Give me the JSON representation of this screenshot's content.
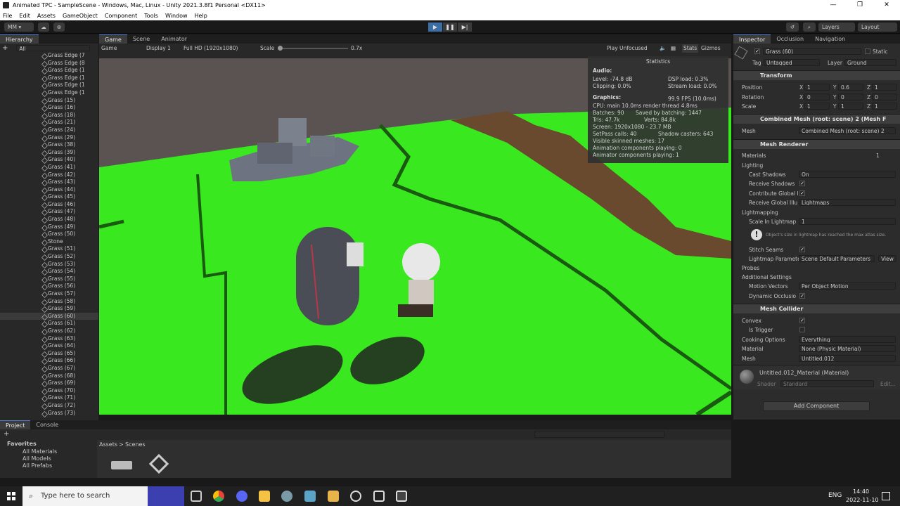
{
  "window": {
    "title": "Animated TPC - SampleScene - Windows, Mac, Linux - Unity 2021.3.8f1 Personal <DX11>",
    "min": "—",
    "max": "❐",
    "close": "✕"
  },
  "menu": [
    "File",
    "Edit",
    "Assets",
    "GameObject",
    "Component",
    "Tools",
    "Window",
    "Help"
  ],
  "toolbar": {
    "account": "MM ▾",
    "layers": "Layers",
    "layout": "Layout"
  },
  "hierarchy": {
    "tab": "Hierarchy",
    "search_placeholder": "All",
    "items": [
      "Grass Edge (7",
      "Grass Edge (8",
      "Grass Edge (1",
      "Grass Edge (1",
      "Grass Edge (1",
      "Grass Edge (1",
      "Grass (15)",
      "Grass (16)",
      "Grass (18)",
      "Grass (21)",
      "Grass (24)",
      "Grass (29)",
      "Grass (38)",
      "Grass (39)",
      "Grass (40)",
      "Grass (41)",
      "Grass (42)",
      "Grass (43)",
      "Grass (44)",
      "Grass (45)",
      "Grass (46)",
      "Grass (47)",
      "Grass (48)",
      "Grass (49)",
      "Grass (50)",
      "Stone",
      "Grass (51)",
      "Grass (52)",
      "Grass (53)",
      "Grass (54)",
      "Grass (55)",
      "Grass (56)",
      "Grass (57)",
      "Grass (58)",
      "Grass (59)",
      "Grass (60)",
      "Grass (61)",
      "Grass (62)",
      "Grass (63)",
      "Grass (64)",
      "Grass (65)",
      "Grass (66)",
      "Grass (67)",
      "Grass (68)",
      "Grass (69)",
      "Grass (70)",
      "Grass (71)",
      "Grass (72)",
      "Grass (73)"
    ],
    "selected_index": 35
  },
  "game": {
    "tabs": [
      "Game",
      "Scene",
      "Animator"
    ],
    "mode": "Game",
    "display": "Display 1",
    "resolution": "Full HD (1920x1080)",
    "scale_label": "Scale",
    "scale_value": "0.7x",
    "play_mode": "Play Unfocused",
    "stats_btn": "Stats",
    "gizmos_btn": "Gizmos"
  },
  "stats": {
    "title": "Statistics",
    "audio": "Audio:",
    "level": "Level: -74.8 dB",
    "clipping": "Clipping: 0.0%",
    "dsp": "DSP load: 0.3%",
    "stream": "Stream load: 0.0%",
    "graphics": "Graphics:",
    "fps": "99.9 FPS (10.0ms)",
    "cpu": "CPU: main 10.0ms  render thread 4.8ms",
    "batches": "Batches: 90",
    "saved": "Saved by batching: 1447",
    "tris": "Tris: 47.7k",
    "verts": "Verts: 84.8k",
    "screen": "Screen: 1920x1080 - 23.7 MB",
    "setpass": "SetPass calls: 40",
    "shadow": "Shadow casters: 643",
    "skinned": "Visible skinned meshes: 17",
    "anim": "Animation components playing: 0",
    "animator": "Animator components playing: 1"
  },
  "inspector": {
    "tabs": [
      "Inspector",
      "Occlusion",
      "Navigation"
    ],
    "object_name": "Grass (60)",
    "static": "Static",
    "tag_label": "Tag",
    "tag": "Untagged",
    "layer_label": "Layer",
    "layer": "Ground",
    "transform": "Transform",
    "position": "Position",
    "pos": [
      "1",
      "0.6",
      "1"
    ],
    "rotation": "Rotation",
    "rot": [
      "0",
      "0",
      "0"
    ],
    "scale": "Scale",
    "scl": [
      "1",
      "1",
      "1"
    ],
    "mesh_filter": "Combined Mesh (root: scene) 2 (Mesh F",
    "mesh_label": "Mesh",
    "mesh_value": "Combined Mesh (root: scene) 2",
    "mesh_renderer": "Mesh Renderer",
    "materials": "Materials",
    "materials_count": "1",
    "lighting": "Lighting",
    "cast_shadows": "Cast Shadows",
    "cast_shadows_v": "On",
    "receive_shadows": "Receive Shadows",
    "contribute_gi": "Contribute Global I",
    "receive_gi": "Receive Global Illu",
    "receive_gi_v": "Lightmaps",
    "lightmapping": "Lightmapping",
    "scale_lightmap": "Scale In Lightmap",
    "scale_lightmap_v": "1",
    "lightmap_warn": "Object's size in lightmap has reached the max atlas size.",
    "stitch": "Stitch Seams",
    "lightmap_params": "Lightmap Paramete",
    "lightmap_params_v": "Scene Default Parameters",
    "view": "View",
    "probes": "Probes",
    "additional": "Additional Settings",
    "motion": "Motion Vectors",
    "motion_v": "Per Object Motion",
    "dynamic_occ": "Dynamic Occlusio",
    "mesh_collider": "Mesh Collider",
    "convex": "Convex",
    "is_trigger": "Is Trigger",
    "cooking": "Cooking Options",
    "cooking_v": "Everything",
    "material": "Material",
    "material_v": "None (Physic Material)",
    "mesh2": "Mesh",
    "mesh2_v": "Untitled.012",
    "mat_name": "Untitled.012_Material (Material)",
    "shader_label": "Shader",
    "shader": "Standard",
    "edit": "Edit...",
    "add_component": "Add Component"
  },
  "project": {
    "tabs": [
      "Project",
      "Console"
    ],
    "favorites": "Favorites",
    "fav_items": [
      "All Materials",
      "All Models",
      "All Prefabs"
    ],
    "breadcrumb_root": "Assets",
    "breadcrumb_sep": ">",
    "breadcrumb_leaf": "Scenes"
  },
  "taskbar": {
    "search": "Type here to search",
    "lang": "ENG",
    "time": "14:40",
    "date": "2022-11-10"
  },
  "colors": {
    "grass": "#39e81f",
    "path": "#6a4a2e",
    "sky": "#5e5654",
    "accent": "#3b6ea5"
  }
}
